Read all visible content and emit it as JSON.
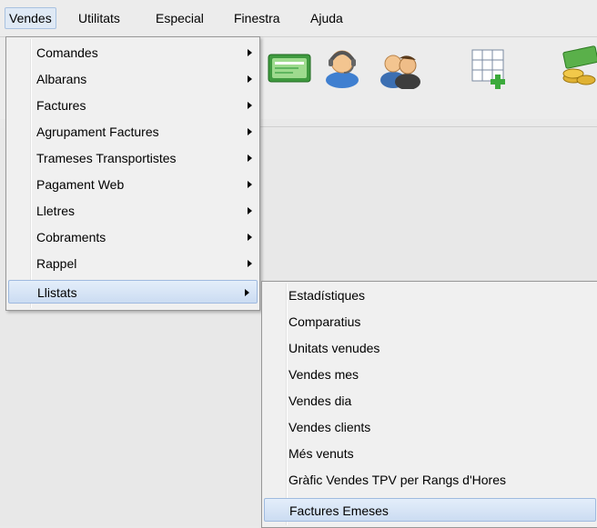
{
  "menubar": {
    "items": [
      {
        "label": "Vendes"
      },
      {
        "label": "Utilitats"
      },
      {
        "label": "Especial"
      },
      {
        "label": "Finestra"
      },
      {
        "label": "Ajuda"
      }
    ]
  },
  "toolbar": {
    "icons": [
      "card-icon",
      "support-agent-icon",
      "users-icon",
      "add-grid-icon",
      "money-coins-icon"
    ]
  },
  "vendes_menu": {
    "items": [
      {
        "label": "Comandes",
        "submenu": true
      },
      {
        "label": "Albarans",
        "submenu": true
      },
      {
        "label": "Factures",
        "submenu": true
      },
      {
        "label": "Agrupament Factures",
        "submenu": true
      },
      {
        "label": "Trameses Transportistes",
        "submenu": true
      },
      {
        "label": "Pagament Web",
        "submenu": true
      },
      {
        "label": "Lletres",
        "submenu": true
      },
      {
        "label": "Cobraments",
        "submenu": true
      },
      {
        "label": "Rappel",
        "submenu": true
      },
      {
        "label": "Llistats",
        "submenu": true,
        "highlighted": true
      }
    ]
  },
  "llistats_submenu": {
    "items": [
      {
        "label": "Estadístiques"
      },
      {
        "label": "Comparatius"
      },
      {
        "label": "Unitats venudes"
      },
      {
        "label": "Vendes mes"
      },
      {
        "label": "Vendes dia"
      },
      {
        "label": "Vendes clients"
      },
      {
        "label": "Més venuts"
      },
      {
        "label": "Gràfic Vendes TPV per Rangs d'Hores"
      },
      {
        "label": "Factures Emeses",
        "highlighted": true
      }
    ]
  }
}
